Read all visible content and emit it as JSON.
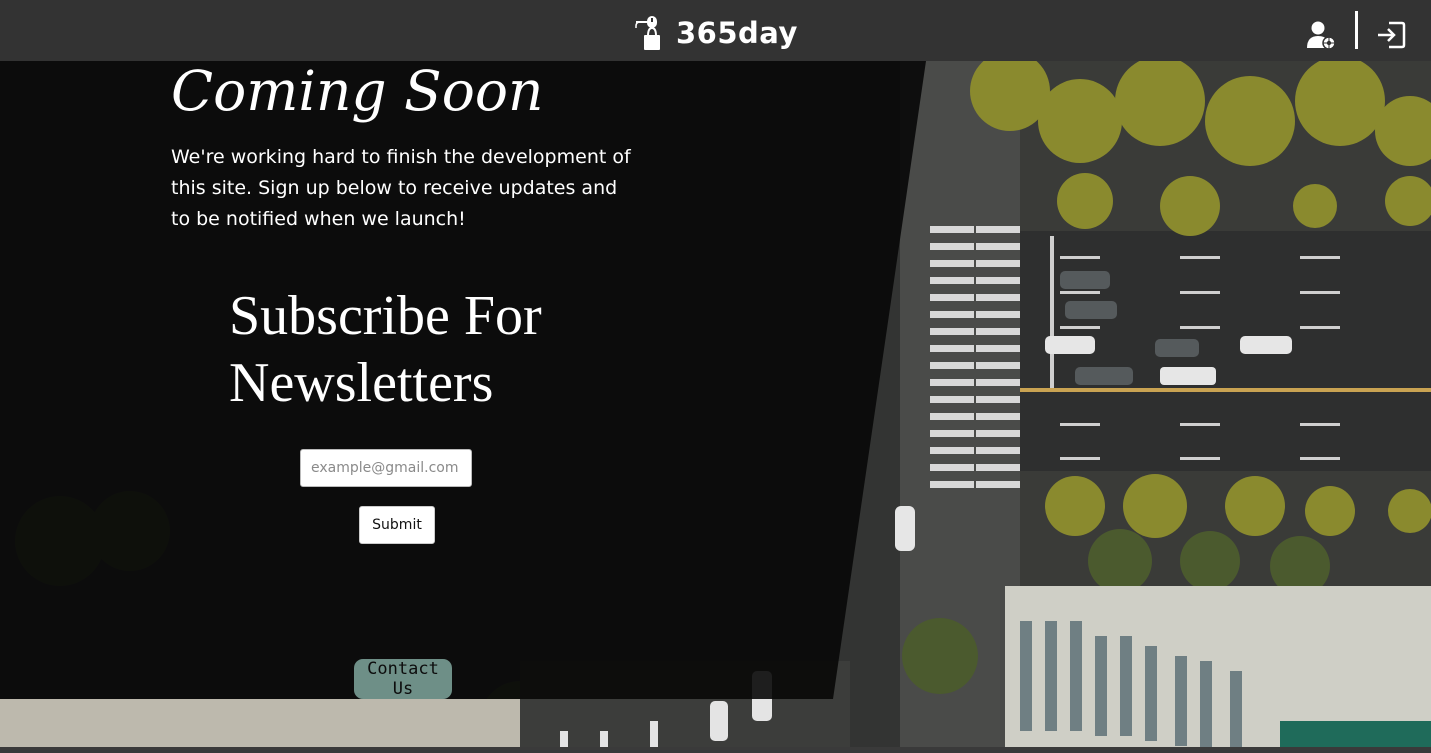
{
  "header": {
    "brand_name": "365day",
    "brand_icon": "shopping-bag-mouse-icon",
    "user_icon": "user-settings-icon",
    "login_icon": "sign-in-icon"
  },
  "hero": {
    "title": "Coming Soon",
    "description": "We're working hard to finish the development of this site. Sign up below to receive updates and to be notified when we launch!"
  },
  "newsletter": {
    "title": "Subscribe For Newsletters",
    "email_placeholder": "example@gmail.com",
    "email_value": "",
    "submit_label": "Submit"
  },
  "contact": {
    "label": "Contact Us"
  },
  "colors": {
    "topbar": "#333333",
    "overlay": "#080808",
    "contact_button": "#6e8f87",
    "text": "#ffffff"
  }
}
